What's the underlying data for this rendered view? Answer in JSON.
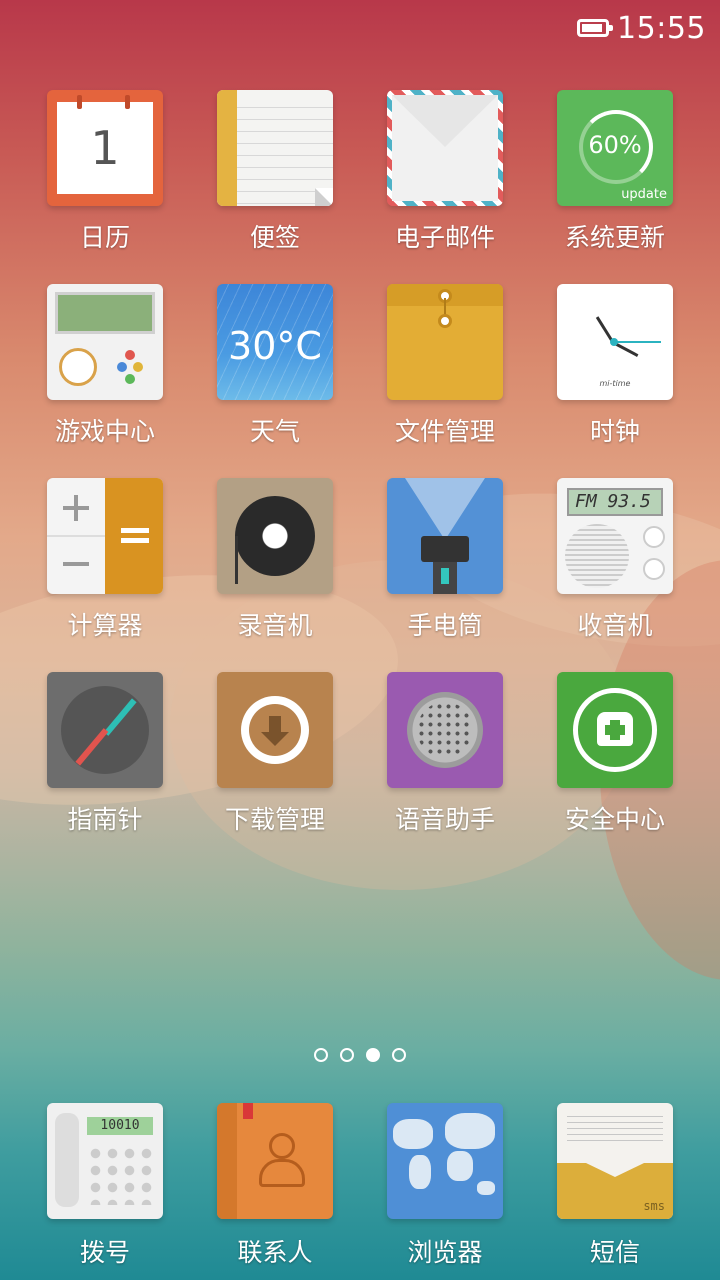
{
  "status_bar": {
    "time": "15:55"
  },
  "apps": {
    "calendar": {
      "label": "日历",
      "date": "1"
    },
    "notes": {
      "label": "便签"
    },
    "email": {
      "label": "电子邮件"
    },
    "system_update": {
      "label": "系统更新",
      "percent": "60%",
      "caption": "update"
    },
    "game_center": {
      "label": "游戏中心"
    },
    "weather": {
      "label": "天气",
      "temperature": "30°C"
    },
    "file_manager": {
      "label": "文件管理"
    },
    "clock": {
      "label": "时钟",
      "brand": "mi-time"
    },
    "calculator": {
      "label": "计算器"
    },
    "recorder": {
      "label": "录音机"
    },
    "flashlight": {
      "label": "手电筒"
    },
    "radio": {
      "label": "收音机",
      "display": "FM  93.5"
    },
    "compass": {
      "label": "指南针"
    },
    "download_manager": {
      "label": "下载管理"
    },
    "voice_assistant": {
      "label": "语音助手"
    },
    "security_center": {
      "label": "安全中心"
    }
  },
  "pager": {
    "pages": 4,
    "active": 3
  },
  "dock": {
    "dialer": {
      "label": "拨号",
      "display": "10010"
    },
    "contacts": {
      "label": "联系人"
    },
    "browser": {
      "label": "浏览器"
    },
    "messages": {
      "label": "短信",
      "caption": "sms"
    }
  }
}
